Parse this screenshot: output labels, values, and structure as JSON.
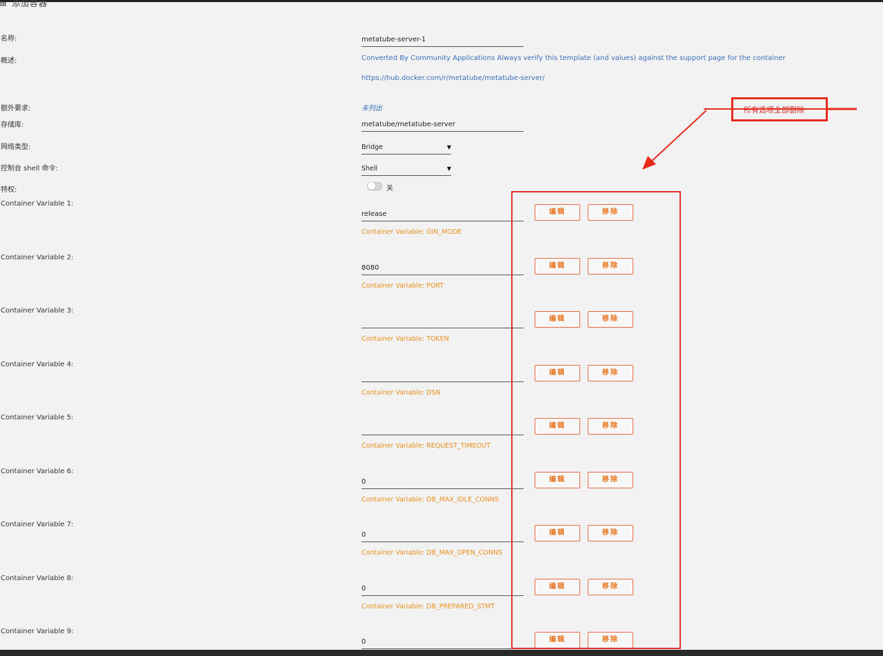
{
  "header": {
    "title": "添加容器",
    "menu_icon": "grid-icon"
  },
  "fields": {
    "name": {
      "label": "名称:",
      "value": "metatube-server-1"
    },
    "overview": {
      "label": "概述:",
      "description": "Converted By Community Applications Always verify this template (and values) against the support page for the container",
      "url": "https://hub.docker.com/r/metatube/metatube-server/"
    },
    "extra_requirements": {
      "label": "额外要求:",
      "value": "未列出"
    },
    "repository": {
      "label": "存储库:",
      "value": "metatube/metatube-server"
    },
    "network_type": {
      "label": "网络类型:",
      "value": "Bridge"
    },
    "console_shell": {
      "label": "控制台 shell 命令:",
      "value": "Shell"
    },
    "privileged": {
      "label": "特权:",
      "state": "关"
    }
  },
  "variables": [
    {
      "label": "Container Variable 1:",
      "value": "release",
      "desc": "Container Variable: GIN_MODE"
    },
    {
      "label": "Container Variable 2:",
      "value": "8080",
      "desc": "Container Variable: PORT"
    },
    {
      "label": "Container Variable 3:",
      "value": "",
      "desc": "Container Variable: TOKEN"
    },
    {
      "label": "Container Variable 4:",
      "value": "",
      "desc": "Container Variable: DSN"
    },
    {
      "label": "Container Variable 5:",
      "value": "",
      "desc": "Container Variable: REQUEST_TIMEOUT"
    },
    {
      "label": "Container Variable 6:",
      "value": "0",
      "desc": "Container Variable: DB_MAX_IDLE_CONNS"
    },
    {
      "label": "Container Variable 7:",
      "value": "0",
      "desc": "Container Variable: DB_MAX_OPEN_CONNS"
    },
    {
      "label": "Container Variable 8:",
      "value": "0",
      "desc": "Container Variable: DB_PREPARED_STMT"
    },
    {
      "label": "Container Variable 9:",
      "value": "0",
      "desc": ""
    }
  ],
  "buttons": {
    "edit_label": "编辑",
    "remove_label": "移除"
  },
  "annotation": {
    "note": "所有选项全部删除",
    "color": "#e82a1a"
  },
  "colors": {
    "accent": "#e8741f",
    "link": "#3b6fb8",
    "desc": "#e8901c"
  }
}
